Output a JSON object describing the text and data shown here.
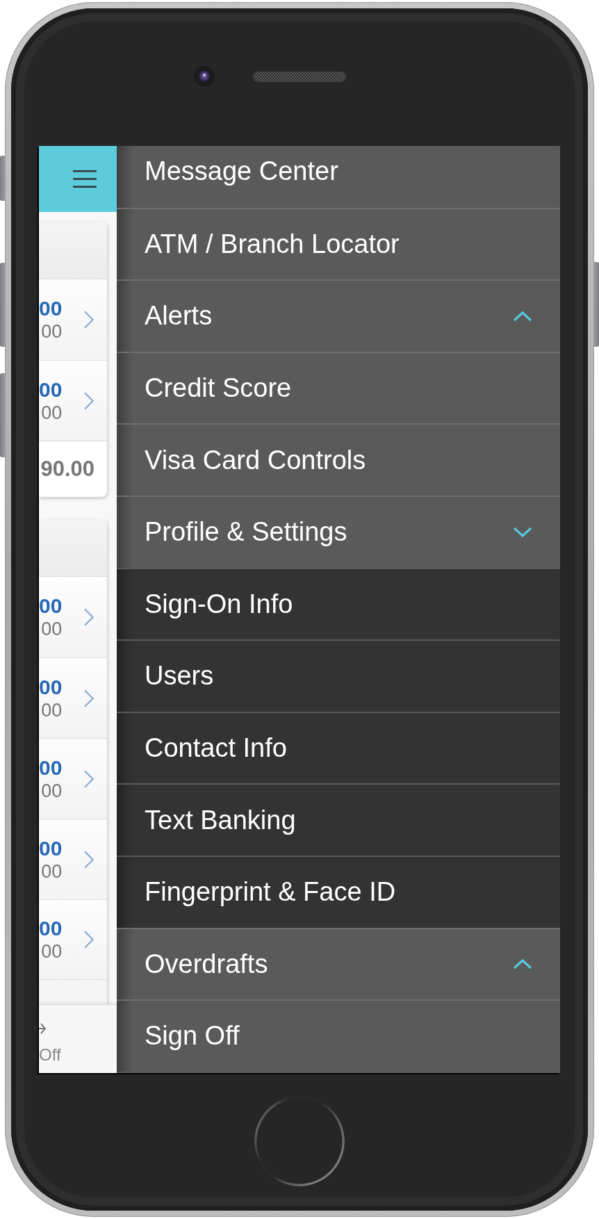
{
  "main_page": {
    "cards": [
      {
        "rows": [
          {
            "amount": "00",
            "balance": "00"
          },
          {
            "amount": "00",
            "balance": "00"
          }
        ],
        "total": "90.00"
      },
      {
        "rows": [
          {
            "amount": "00",
            "balance": "00"
          },
          {
            "amount": "00",
            "balance": "00"
          },
          {
            "amount": "00",
            "balance": "00"
          },
          {
            "amount": "00",
            "balance": "00"
          },
          {
            "amount": "00",
            "balance": "00"
          }
        ]
      }
    ]
  },
  "tab_bar": {
    "items": [
      {
        "label": "Off"
      }
    ]
  },
  "menu": {
    "items": [
      {
        "label": "Message Center",
        "kind": "link"
      },
      {
        "label": "ATM / Branch Locator",
        "kind": "link"
      },
      {
        "label": "Alerts",
        "kind": "group",
        "expanded": false
      },
      {
        "label": "Credit Score",
        "kind": "link"
      },
      {
        "label": "Visa Card Controls",
        "kind": "link"
      },
      {
        "label": "Profile & Settings",
        "kind": "group",
        "expanded": true,
        "children": [
          {
            "label": "Sign-On Info"
          },
          {
            "label": "Users"
          },
          {
            "label": "Contact Info"
          },
          {
            "label": "Text Banking"
          },
          {
            "label": "Fingerprint & Face ID"
          }
        ]
      },
      {
        "label": "Overdrafts",
        "kind": "group",
        "expanded": false
      },
      {
        "label": "Sign Off",
        "kind": "link"
      }
    ]
  }
}
